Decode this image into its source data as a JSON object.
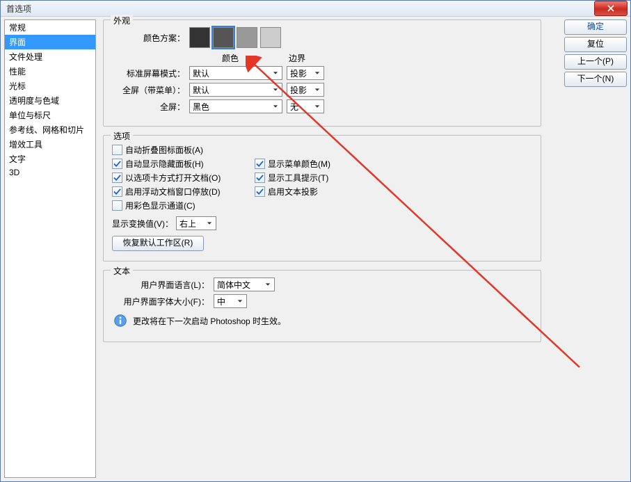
{
  "window_title": "首选项",
  "sidebar": {
    "items": [
      {
        "label": "常规"
      },
      {
        "label": "界面"
      },
      {
        "label": "文件处理"
      },
      {
        "label": "性能"
      },
      {
        "label": "光标"
      },
      {
        "label": "透明度与色域"
      },
      {
        "label": "单位与标尺"
      },
      {
        "label": "参考线、网格和切片"
      },
      {
        "label": "增效工具"
      },
      {
        "label": "文字"
      },
      {
        "label": "3D"
      }
    ],
    "selected_index": 1
  },
  "buttons": {
    "ok": "确定",
    "reset": "复位",
    "prev": "上一个(P)",
    "next": "下一个(N)"
  },
  "appearance": {
    "legend": "外观",
    "scheme_label": "颜色方案：",
    "swatches": [
      "#333333",
      "#555555",
      "#999999",
      "#cccccc"
    ],
    "selected_swatch": 1,
    "col_color": "颜色",
    "col_border": "边界",
    "rows": [
      {
        "label": "标准屏幕模式：",
        "color": "默认",
        "border": "投影"
      },
      {
        "label": "全屏（带菜单）：",
        "color": "默认",
        "border": "投影"
      },
      {
        "label": "全屏：",
        "color": "黑色",
        "border": "无"
      }
    ]
  },
  "options": {
    "legend": "选项",
    "checkboxes_left": [
      {
        "label": "自动折叠图标面板(A)",
        "checked": false
      },
      {
        "label": "自动显示隐藏面板(H)",
        "checked": true
      },
      {
        "label": "以选项卡方式打开文档(O)",
        "checked": true
      },
      {
        "label": "启用浮动文档窗口停放(D)",
        "checked": true
      },
      {
        "label": "用彩色显示通道(C)",
        "checked": false
      }
    ],
    "checkboxes_right": [
      {
        "label": "显示菜单颜色(M)",
        "checked": true
      },
      {
        "label": "显示工具提示(T)",
        "checked": true
      },
      {
        "label": "启用文本投影",
        "checked": true
      }
    ],
    "transform_label": "显示变换值(V)：",
    "transform_value": "右上",
    "restore_btn": "恢复默认工作区(R)"
  },
  "text": {
    "legend": "文本",
    "lang_label": "用户界面语言(L)：",
    "lang_value": "简体中文",
    "size_label": "用户界面字体大小(F)：",
    "size_value": "中",
    "notice": "更改将在下一次启动 Photoshop 时生效。"
  }
}
